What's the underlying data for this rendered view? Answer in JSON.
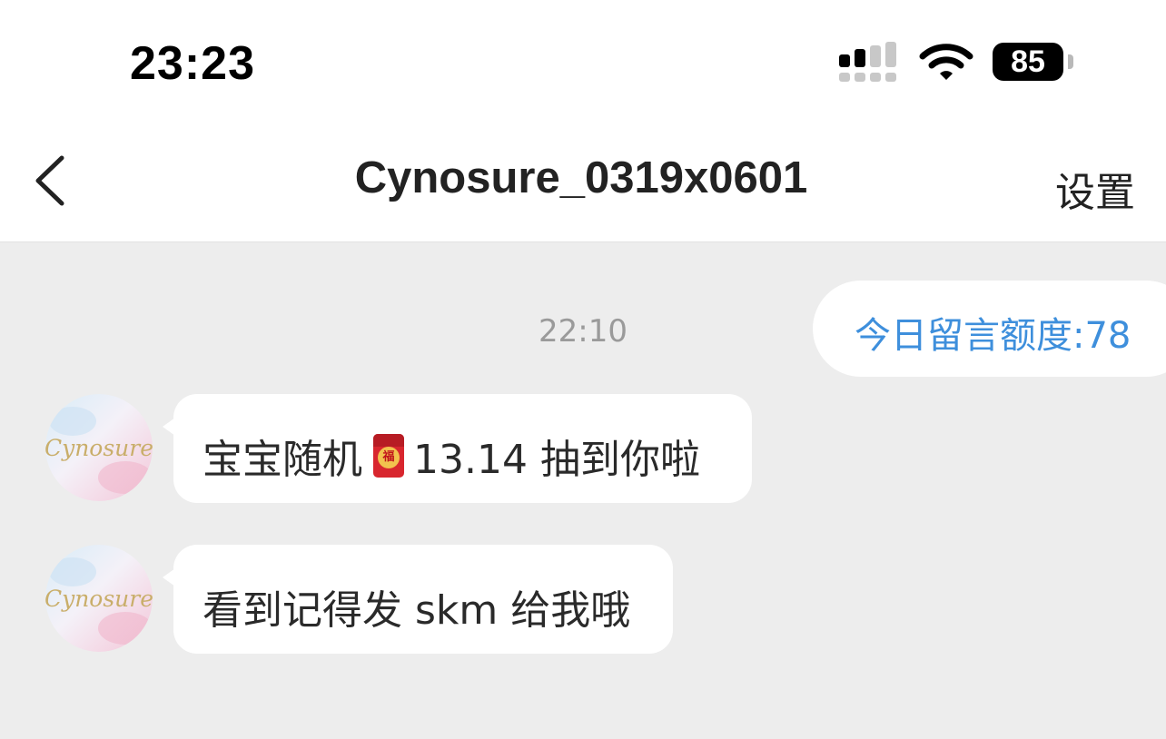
{
  "status_bar": {
    "time": "23:23",
    "battery": "85",
    "icons": [
      "signal-icon",
      "wifi-icon",
      "battery-icon"
    ]
  },
  "header": {
    "back_icon": "chevron-left-icon",
    "title": "Cynosure_0319x0601",
    "settings_label": "设置"
  },
  "chat": {
    "quota_message": "今日留言额度:78",
    "timestamp": "22:10",
    "messages": [
      {
        "sender": "Cynosure",
        "text_before": "宝宝随机",
        "emoji": "red-envelope-icon",
        "emoji_char": "福",
        "text_after": "13.14 抽到你啦"
      },
      {
        "sender": "Cynosure",
        "text": "看到记得发 skm 给我哦"
      }
    ]
  },
  "colors": {
    "chat_background": "#ededed",
    "quota_text": "#3e8fdc",
    "timestamp_text": "#9a9a9a",
    "bubble": "#ffffff"
  }
}
